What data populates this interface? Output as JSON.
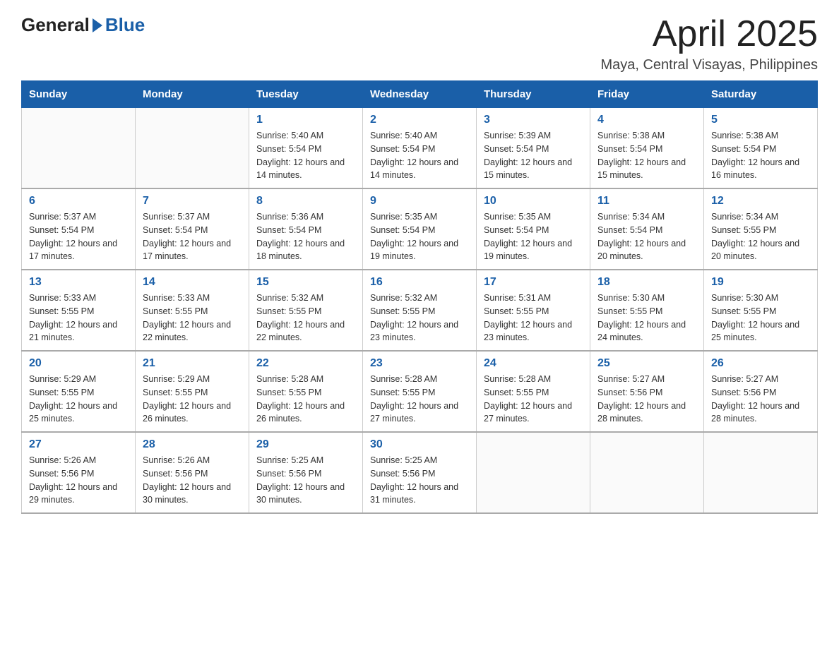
{
  "header": {
    "logo_general": "General",
    "logo_blue": "Blue",
    "title": "April 2025",
    "subtitle": "Maya, Central Visayas, Philippines"
  },
  "weekdays": [
    "Sunday",
    "Monday",
    "Tuesday",
    "Wednesday",
    "Thursday",
    "Friday",
    "Saturday"
  ],
  "weeks": [
    [
      {
        "day": "",
        "sunrise": "",
        "sunset": "",
        "daylight": ""
      },
      {
        "day": "",
        "sunrise": "",
        "sunset": "",
        "daylight": ""
      },
      {
        "day": "1",
        "sunrise": "Sunrise: 5:40 AM",
        "sunset": "Sunset: 5:54 PM",
        "daylight": "Daylight: 12 hours and 14 minutes."
      },
      {
        "day": "2",
        "sunrise": "Sunrise: 5:40 AM",
        "sunset": "Sunset: 5:54 PM",
        "daylight": "Daylight: 12 hours and 14 minutes."
      },
      {
        "day": "3",
        "sunrise": "Sunrise: 5:39 AM",
        "sunset": "Sunset: 5:54 PM",
        "daylight": "Daylight: 12 hours and 15 minutes."
      },
      {
        "day": "4",
        "sunrise": "Sunrise: 5:38 AM",
        "sunset": "Sunset: 5:54 PM",
        "daylight": "Daylight: 12 hours and 15 minutes."
      },
      {
        "day": "5",
        "sunrise": "Sunrise: 5:38 AM",
        "sunset": "Sunset: 5:54 PM",
        "daylight": "Daylight: 12 hours and 16 minutes."
      }
    ],
    [
      {
        "day": "6",
        "sunrise": "Sunrise: 5:37 AM",
        "sunset": "Sunset: 5:54 PM",
        "daylight": "Daylight: 12 hours and 17 minutes."
      },
      {
        "day": "7",
        "sunrise": "Sunrise: 5:37 AM",
        "sunset": "Sunset: 5:54 PM",
        "daylight": "Daylight: 12 hours and 17 minutes."
      },
      {
        "day": "8",
        "sunrise": "Sunrise: 5:36 AM",
        "sunset": "Sunset: 5:54 PM",
        "daylight": "Daylight: 12 hours and 18 minutes."
      },
      {
        "day": "9",
        "sunrise": "Sunrise: 5:35 AM",
        "sunset": "Sunset: 5:54 PM",
        "daylight": "Daylight: 12 hours and 19 minutes."
      },
      {
        "day": "10",
        "sunrise": "Sunrise: 5:35 AM",
        "sunset": "Sunset: 5:54 PM",
        "daylight": "Daylight: 12 hours and 19 minutes."
      },
      {
        "day": "11",
        "sunrise": "Sunrise: 5:34 AM",
        "sunset": "Sunset: 5:54 PM",
        "daylight": "Daylight: 12 hours and 20 minutes."
      },
      {
        "day": "12",
        "sunrise": "Sunrise: 5:34 AM",
        "sunset": "Sunset: 5:55 PM",
        "daylight": "Daylight: 12 hours and 20 minutes."
      }
    ],
    [
      {
        "day": "13",
        "sunrise": "Sunrise: 5:33 AM",
        "sunset": "Sunset: 5:55 PM",
        "daylight": "Daylight: 12 hours and 21 minutes."
      },
      {
        "day": "14",
        "sunrise": "Sunrise: 5:33 AM",
        "sunset": "Sunset: 5:55 PM",
        "daylight": "Daylight: 12 hours and 22 minutes."
      },
      {
        "day": "15",
        "sunrise": "Sunrise: 5:32 AM",
        "sunset": "Sunset: 5:55 PM",
        "daylight": "Daylight: 12 hours and 22 minutes."
      },
      {
        "day": "16",
        "sunrise": "Sunrise: 5:32 AM",
        "sunset": "Sunset: 5:55 PM",
        "daylight": "Daylight: 12 hours and 23 minutes."
      },
      {
        "day": "17",
        "sunrise": "Sunrise: 5:31 AM",
        "sunset": "Sunset: 5:55 PM",
        "daylight": "Daylight: 12 hours and 23 minutes."
      },
      {
        "day": "18",
        "sunrise": "Sunrise: 5:30 AM",
        "sunset": "Sunset: 5:55 PM",
        "daylight": "Daylight: 12 hours and 24 minutes."
      },
      {
        "day": "19",
        "sunrise": "Sunrise: 5:30 AM",
        "sunset": "Sunset: 5:55 PM",
        "daylight": "Daylight: 12 hours and 25 minutes."
      }
    ],
    [
      {
        "day": "20",
        "sunrise": "Sunrise: 5:29 AM",
        "sunset": "Sunset: 5:55 PM",
        "daylight": "Daylight: 12 hours and 25 minutes."
      },
      {
        "day": "21",
        "sunrise": "Sunrise: 5:29 AM",
        "sunset": "Sunset: 5:55 PM",
        "daylight": "Daylight: 12 hours and 26 minutes."
      },
      {
        "day": "22",
        "sunrise": "Sunrise: 5:28 AM",
        "sunset": "Sunset: 5:55 PM",
        "daylight": "Daylight: 12 hours and 26 minutes."
      },
      {
        "day": "23",
        "sunrise": "Sunrise: 5:28 AM",
        "sunset": "Sunset: 5:55 PM",
        "daylight": "Daylight: 12 hours and 27 minutes."
      },
      {
        "day": "24",
        "sunrise": "Sunrise: 5:28 AM",
        "sunset": "Sunset: 5:55 PM",
        "daylight": "Daylight: 12 hours and 27 minutes."
      },
      {
        "day": "25",
        "sunrise": "Sunrise: 5:27 AM",
        "sunset": "Sunset: 5:56 PM",
        "daylight": "Daylight: 12 hours and 28 minutes."
      },
      {
        "day": "26",
        "sunrise": "Sunrise: 5:27 AM",
        "sunset": "Sunset: 5:56 PM",
        "daylight": "Daylight: 12 hours and 28 minutes."
      }
    ],
    [
      {
        "day": "27",
        "sunrise": "Sunrise: 5:26 AM",
        "sunset": "Sunset: 5:56 PM",
        "daylight": "Daylight: 12 hours and 29 minutes."
      },
      {
        "day": "28",
        "sunrise": "Sunrise: 5:26 AM",
        "sunset": "Sunset: 5:56 PM",
        "daylight": "Daylight: 12 hours and 30 minutes."
      },
      {
        "day": "29",
        "sunrise": "Sunrise: 5:25 AM",
        "sunset": "Sunset: 5:56 PM",
        "daylight": "Daylight: 12 hours and 30 minutes."
      },
      {
        "day": "30",
        "sunrise": "Sunrise: 5:25 AM",
        "sunset": "Sunset: 5:56 PM",
        "daylight": "Daylight: 12 hours and 31 minutes."
      },
      {
        "day": "",
        "sunrise": "",
        "sunset": "",
        "daylight": ""
      },
      {
        "day": "",
        "sunrise": "",
        "sunset": "",
        "daylight": ""
      },
      {
        "day": "",
        "sunrise": "",
        "sunset": "",
        "daylight": ""
      }
    ]
  ]
}
